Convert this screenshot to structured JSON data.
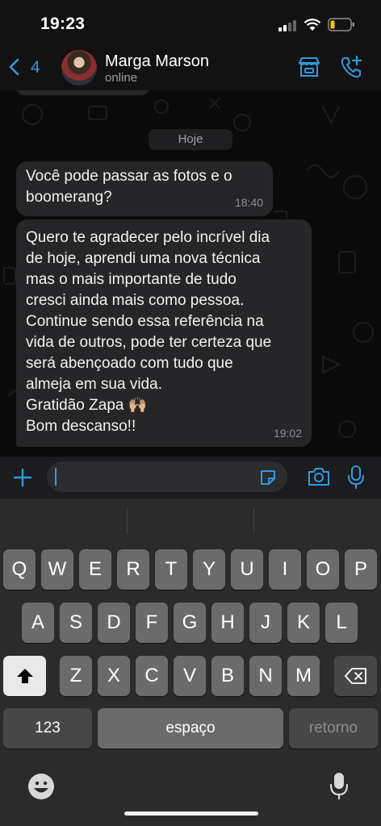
{
  "status_bar": {
    "time": "19:23"
  },
  "header": {
    "back_count": "4",
    "contact_name": "Marga Marson",
    "contact_status": "online"
  },
  "chat": {
    "date_label": "Hoje",
    "messages": [
      {
        "text": "Você pode passar as fotos e o\nboomerang?",
        "time": "18:40"
      },
      {
        "text": "Quero te agradecer pelo incrível dia\nde hoje, aprendi uma nova técnica\nmas o mais importante de tudo\ncresci ainda mais como pessoa.\nContinue sendo essa referência na\nvida de outros, pode ter certeza que\nserá abençoado com tudo que\nalmeja em sua vida.\nGratidão Zapa 🙌🏼\nBom descanso!!",
        "time": "19:02"
      }
    ]
  },
  "input": {
    "placeholder": ""
  },
  "keyboard": {
    "row1": [
      "Q",
      "W",
      "E",
      "R",
      "T",
      "Y",
      "U",
      "I",
      "O",
      "P"
    ],
    "row2": [
      "A",
      "S",
      "D",
      "F",
      "G",
      "H",
      "J",
      "K",
      "L"
    ],
    "row3": [
      "Z",
      "X",
      "C",
      "V",
      "B",
      "N",
      "M"
    ],
    "numbers_key": "123",
    "space_key": "espaço",
    "return_key": "retorno"
  },
  "colors": {
    "accent": "#2f9bde",
    "bubble": "#262628",
    "background": "#0b0b0c"
  },
  "icons": [
    "back-chevron-icon",
    "store-icon",
    "add-call-icon",
    "plus-icon",
    "sticker-icon",
    "camera-icon",
    "microphone-icon",
    "shift-icon",
    "backspace-icon",
    "emoji-icon",
    "dictation-icon",
    "signal-icon",
    "wifi-icon",
    "battery-icon"
  ]
}
